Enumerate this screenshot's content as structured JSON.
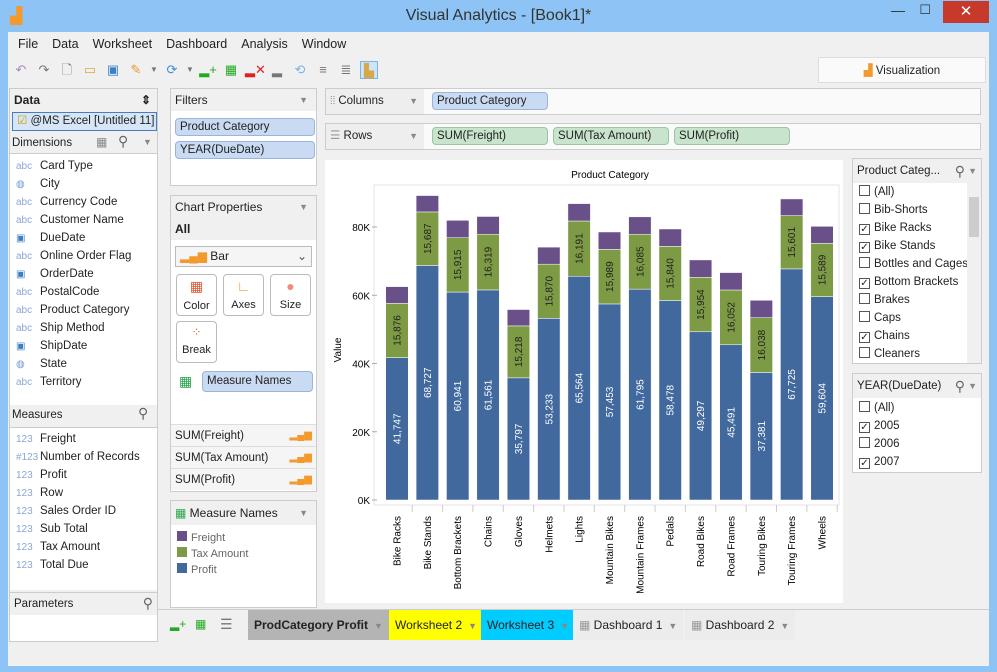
{
  "window": {
    "title": "Visual Analytics - [Book1]*",
    "close": "✕",
    "minimize": "—",
    "maximize": "☐"
  },
  "menu": [
    "File",
    "Data",
    "Worksheet",
    "Dashboard",
    "Analysis",
    "Window"
  ],
  "visualization_tab": "Visualization",
  "data_panel": {
    "title": "Data",
    "source": "@MS Excel [Untitled 11]",
    "dimensions_title": "Dimensions",
    "dimensions": [
      {
        "icon": "abc",
        "label": "Card Type"
      },
      {
        "icon": "globe",
        "label": "City"
      },
      {
        "icon": "abc",
        "label": "Currency Code"
      },
      {
        "icon": "abc",
        "label": "Customer Name"
      },
      {
        "icon": "date",
        "label": "DueDate"
      },
      {
        "icon": "abc",
        "label": "Online Order Flag"
      },
      {
        "icon": "date",
        "label": "OrderDate"
      },
      {
        "icon": "abc",
        "label": "PostalCode"
      },
      {
        "icon": "abc",
        "label": "Product Category"
      },
      {
        "icon": "abc",
        "label": "Ship Method"
      },
      {
        "icon": "date",
        "label": "ShipDate"
      },
      {
        "icon": "globe",
        "label": "State"
      },
      {
        "icon": "abc",
        "label": "Territory"
      }
    ],
    "measures_title": "Measures",
    "measures": [
      {
        "icon": "123",
        "label": "Freight"
      },
      {
        "icon": "#123",
        "label": "Number of Records"
      },
      {
        "icon": "123",
        "label": "Profit"
      },
      {
        "icon": "123",
        "label": "Row"
      },
      {
        "icon": "123",
        "label": "Sales Order ID"
      },
      {
        "icon": "123",
        "label": "Sub Total"
      },
      {
        "icon": "123",
        "label": "Tax Amount"
      },
      {
        "icon": "123",
        "label": "Total Due"
      }
    ],
    "parameters_title": "Parameters"
  },
  "filters": {
    "title": "Filters",
    "items": [
      "Product Category",
      "YEAR(DueDate)"
    ]
  },
  "chart_properties": {
    "title": "Chart Properties",
    "scope": "All",
    "chart_type": "Bar",
    "buttons": [
      "Color",
      "Axes",
      "Size",
      "Break"
    ],
    "color_field": "Measure Names",
    "measures": [
      "SUM(Freight)",
      "SUM(Tax Amount)",
      "SUM(Profit)"
    ]
  },
  "legend": {
    "title": "Measure Names",
    "items": [
      {
        "label": "Freight",
        "color": "#6a5089"
      },
      {
        "label": "Tax Amount",
        "color": "#7d9a45"
      },
      {
        "label": "Profit",
        "color": "#41699e"
      }
    ]
  },
  "shelves": {
    "columns_label": "Columns",
    "rows_label": "Rows",
    "columns": [
      "Product Category"
    ],
    "rows": [
      "SUM(Freight)",
      "SUM(Tax Amount)",
      "SUM(Profit)"
    ]
  },
  "chart_data": {
    "type": "bar",
    "stacked": true,
    "title": "Product Category",
    "xlabel": "",
    "ylabel": "Value",
    "ylim": [
      0,
      90000
    ],
    "yticks": [
      "0K",
      "20K",
      "40K",
      "60K",
      "80K"
    ],
    "ytick_values": [
      0,
      20000,
      40000,
      60000,
      80000
    ],
    "categories": [
      "Bike Racks",
      "Bike Stands",
      "Bottom Brackets",
      "Chains",
      "Gloves",
      "Helmets",
      "Lights",
      "Mountain Bikes",
      "Mountain Frames",
      "Pedals",
      "Road Bikes",
      "Road Frames",
      "Touring Bikes",
      "Touring Frames",
      "Wheels"
    ],
    "series": [
      {
        "name": "Profit",
        "color": "#41699e",
        "values": [
          41747,
          68727,
          60941,
          61561,
          35797,
          53233,
          65564,
          57453,
          61795,
          58478,
          49297,
          45491,
          37381,
          67725,
          59604
        ],
        "labels": [
          "41,747",
          "68,727",
          "60,941",
          "61,561",
          "35,797",
          "53,233",
          "65,564",
          "57,453",
          "61,795",
          "58,478",
          "49,297",
          "45,491",
          "37,381",
          "67,725",
          "59,604"
        ]
      },
      {
        "name": "Tax Amount",
        "color": "#7d9a45",
        "values": [
          15876,
          15687,
          15915,
          16319,
          15218,
          15870,
          16191,
          15989,
          16085,
          15840,
          15954,
          16052,
          16038,
          15601,
          15589
        ],
        "labels": [
          "15,876",
          "15,687",
          "15,915",
          "16,319",
          "15,218",
          "15,870",
          "16,191",
          "15,989",
          "16,085",
          "15,840",
          "15,954",
          "16,052",
          "16,038",
          "15,601",
          "15,589"
        ]
      },
      {
        "name": "Freight",
        "color": "#6a5089",
        "values": [
          4900,
          4800,
          5100,
          5200,
          4800,
          5000,
          5100,
          5100,
          5100,
          5100,
          5100,
          5100,
          5100,
          4900,
          5000
        ]
      }
    ]
  },
  "filter_product": {
    "title": "Product Categ...",
    "items": [
      {
        "label": "(All)",
        "checked": false
      },
      {
        "label": "Bib-Shorts",
        "checked": false
      },
      {
        "label": "Bike Racks",
        "checked": true
      },
      {
        "label": "Bike Stands",
        "checked": true
      },
      {
        "label": "Bottles and Cages",
        "checked": false
      },
      {
        "label": "Bottom Brackets",
        "checked": true
      },
      {
        "label": "Brakes",
        "checked": false
      },
      {
        "label": "Caps",
        "checked": false
      },
      {
        "label": "Chains",
        "checked": true
      },
      {
        "label": "Cleaners",
        "checked": false
      }
    ]
  },
  "filter_year": {
    "title": "YEAR(DueDate)",
    "items": [
      {
        "label": "(All)",
        "checked": false
      },
      {
        "label": "2005",
        "checked": true
      },
      {
        "label": "2006",
        "checked": false
      },
      {
        "label": "2007",
        "checked": true
      }
    ]
  },
  "sheet_tabs": [
    {
      "label": "ProdCategory Profit",
      "color": "#b4b4b4",
      "active": true
    },
    {
      "label": "Worksheet 2",
      "color": "#ffff00"
    },
    {
      "label": "Worksheet 3",
      "color": "#00ccff"
    },
    {
      "label": "Dashboard 1",
      "color": "#ececec"
    },
    {
      "label": "Dashboard 2",
      "color": "#ececec"
    }
  ]
}
